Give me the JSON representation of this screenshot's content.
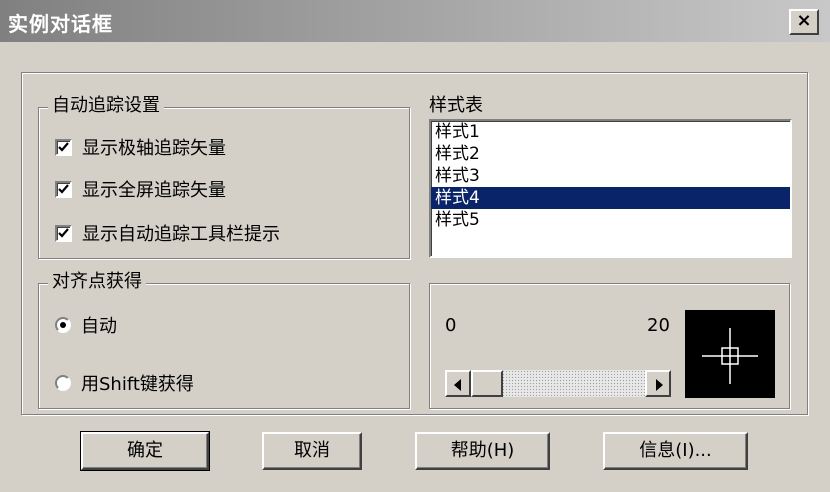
{
  "window": {
    "title": "实例对话框",
    "close_glyph": "×"
  },
  "tracking_group": {
    "legend": "自动追踪设置",
    "options": [
      {
        "label": "显示极轴追踪矢量",
        "checked": true
      },
      {
        "label": "显示全屏追踪矢量",
        "checked": true
      },
      {
        "label": "显示自动追踪工具栏提示",
        "checked": true
      }
    ]
  },
  "style_table": {
    "legend": "样式表",
    "items": [
      "样式1",
      "样式2",
      "样式3",
      "样式4",
      "样式5"
    ],
    "selected_index": 3
  },
  "snap_group": {
    "legend": "对齐点获得",
    "options": [
      {
        "label": "自动",
        "selected": true
      },
      {
        "label": "用Shift键获得",
        "selected": false
      }
    ]
  },
  "preview": {
    "slider_min": "0",
    "slider_max": "20",
    "slider_value_fraction": 0.05
  },
  "buttons": {
    "ok": "确定",
    "cancel": "取消",
    "help": "帮助(H)",
    "info": "信息(I)..."
  },
  "colors": {
    "selection": "#0a246a",
    "dialog_face": "#d4d0c8"
  }
}
